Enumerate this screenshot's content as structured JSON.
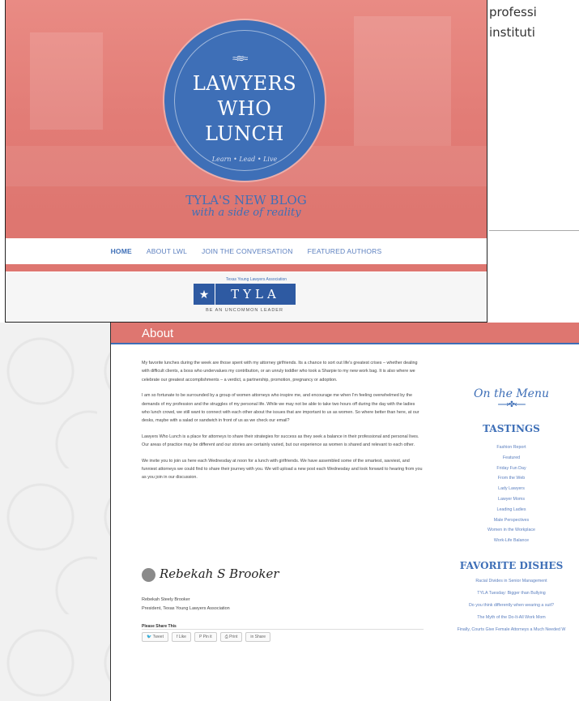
{
  "side_text": [
    "professi",
    "instituti"
  ],
  "blog_header": {
    "logo_lines": [
      "LAWYERS",
      "WHO",
      "LUNCH"
    ],
    "tagline": "Learn • Lead • Live",
    "blog_title": "TYLA'S NEW BLOG",
    "blog_subtitle": "with a side of reality",
    "nav": [
      "HOME",
      "ABOUT LWL",
      "JOIN THE CONVERSATION",
      "FEATURED AUTHORS"
    ],
    "tyla_small": "Texas Young Lawyers Association",
    "tyla_word": "TYLA",
    "tyla_tagline": "BE AN UNCOMMON LEADER"
  },
  "about_page": {
    "title": "About",
    "paragraphs": [
      "My favorite lunches during the week are those spent with my attorney girlfriends. Its a chance to sort out life's greatest crises – whether dealing with difficult clients, a boss who undervalues my contribution, or an unruly toddler who took a Sharpie to my new work bag. It is also where we celebrate our greatest accomplishments – a verdict, a partnership, promotion, pregnancy or adoption.",
      "I am so fortunate to be surrounded by a group of women attorneys who inspire me, and encourage me when I'm feeling overwhelmed by the demands of my profession and the struggles of my personal life. While we may not be able to take two hours off during the day with the ladies who lunch crowd, we still want to connect with each other about the issues that are important to us as women. So where better than here, at our desks, maybe with a salad or sandwich in front of us as we check our email?",
      "Lawyers Who Lunch is a place for attorneys to share their strategies for success as they seek a balance in their professional and personal lives. Our areas of practice may be different and our stories are certainly varied, but our experience as women is shared and relevant to each other.",
      "We invite you to join us here each Wednesday at noon for a lunch with girlfriends. We have assembled some of the smartest, savviest, and funniest attorneys we could find to share their journey with you. We will upload a new post each Wednesday and look forward to hearing from you as you join in our discussion."
    ],
    "signature": "Rebekah S Brooker",
    "author_name": "Rebekah Steely Brooker",
    "author_title": "President, Texas Young Lawyers Association",
    "share_title": "Please Share This",
    "share_buttons": [
      "Tweet",
      "Like",
      "Pin it",
      "Print",
      "Share"
    ]
  },
  "sidebar": {
    "menu_script": "On the Menu",
    "tastings_heading": "TASTINGS",
    "tastings": [
      "Fashion Report",
      "Featured",
      "Friday Fun Day",
      "From the Web",
      "Lady Lawyers",
      "Lawyer Moms",
      "Leading Ladies",
      "Male Perspectives",
      "Women in the Workplace",
      "Work-Life Balance"
    ],
    "dishes_heading": "FAVORITE DISHES",
    "dishes": [
      "Racial Divides in Senior Management",
      "TYLA Tuesday: Bigger than Bullying",
      "Do you think differently when wearing a suit?",
      "The Myth of the Do-It-All Work Mom",
      "Finally, Courts Give Female Attorneys a Much Needed W"
    ]
  }
}
